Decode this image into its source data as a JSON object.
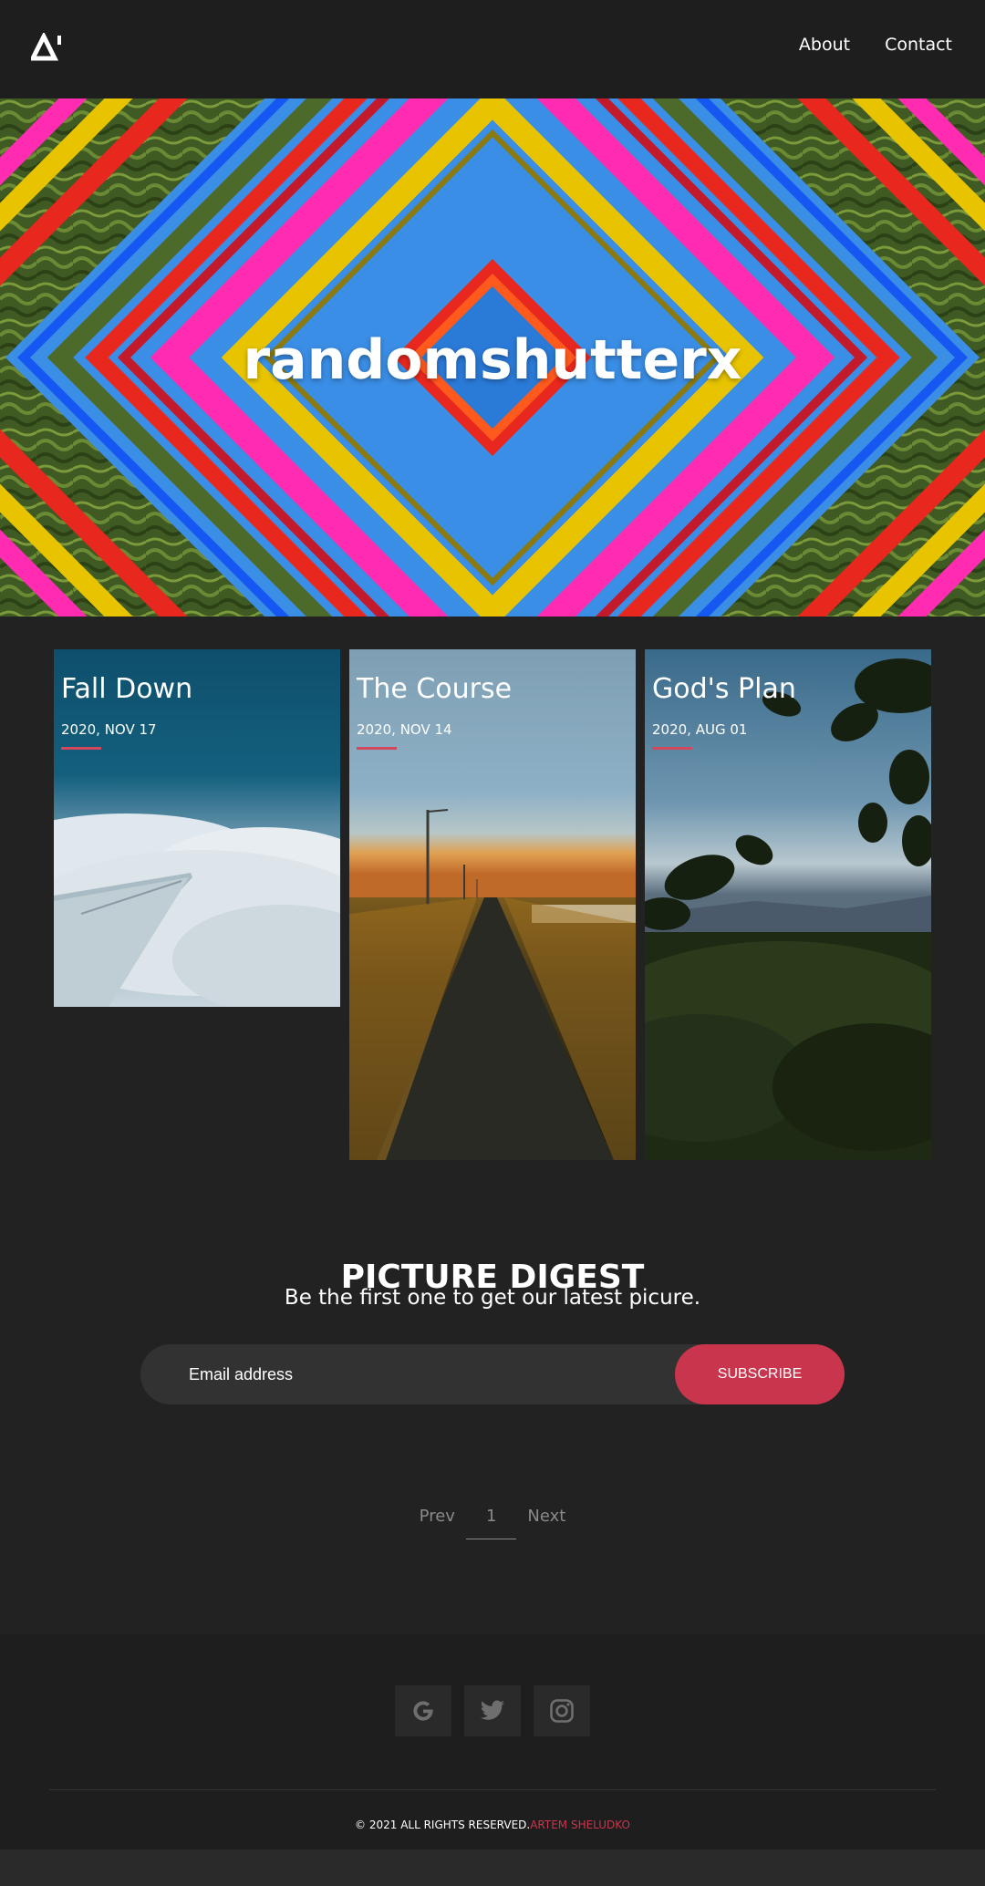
{
  "header": {
    "logo_alt": "Δ'",
    "nav": [
      {
        "label": "About"
      },
      {
        "label": "Contact"
      }
    ]
  },
  "hero": {
    "title": "randomshutterx",
    "colors": {
      "sky": "#3a8ee6",
      "magenta": "#ff2bb0",
      "yellow": "#e8c400",
      "red": "#e8281e",
      "blue": "#1557f0",
      "palm": "#4c6a2a"
    }
  },
  "posts": [
    {
      "title": "Fall Down",
      "date": "2020, NOV 17",
      "image": "airplane-wing-clouds"
    },
    {
      "title": "The Course",
      "date": "2020, NOV 14",
      "image": "road-sunset-streetlights"
    },
    {
      "title": "God's Plan",
      "date": "2020, AUG 01",
      "image": "leaves-valley-sky"
    }
  ],
  "digest": {
    "title": "PICTURE DIGEST",
    "subtitle": "Be the first one to get our latest picure.",
    "email_placeholder": "Email address",
    "subscribe_label": "SUBSCRIBE"
  },
  "pagination": {
    "prev": "Prev",
    "current": "1",
    "next": "Next"
  },
  "footer": {
    "socials": [
      {
        "icon": "google-icon"
      },
      {
        "icon": "twitter-icon"
      },
      {
        "icon": "instagram-icon"
      }
    ],
    "copyright": "© 2021 ALL RIGHTS RESERVED.",
    "author": "ARTEM SHELUDKO"
  },
  "colors": {
    "accent": "#c9354d",
    "background": "#222222",
    "header_bg": "#1e1e1e"
  }
}
